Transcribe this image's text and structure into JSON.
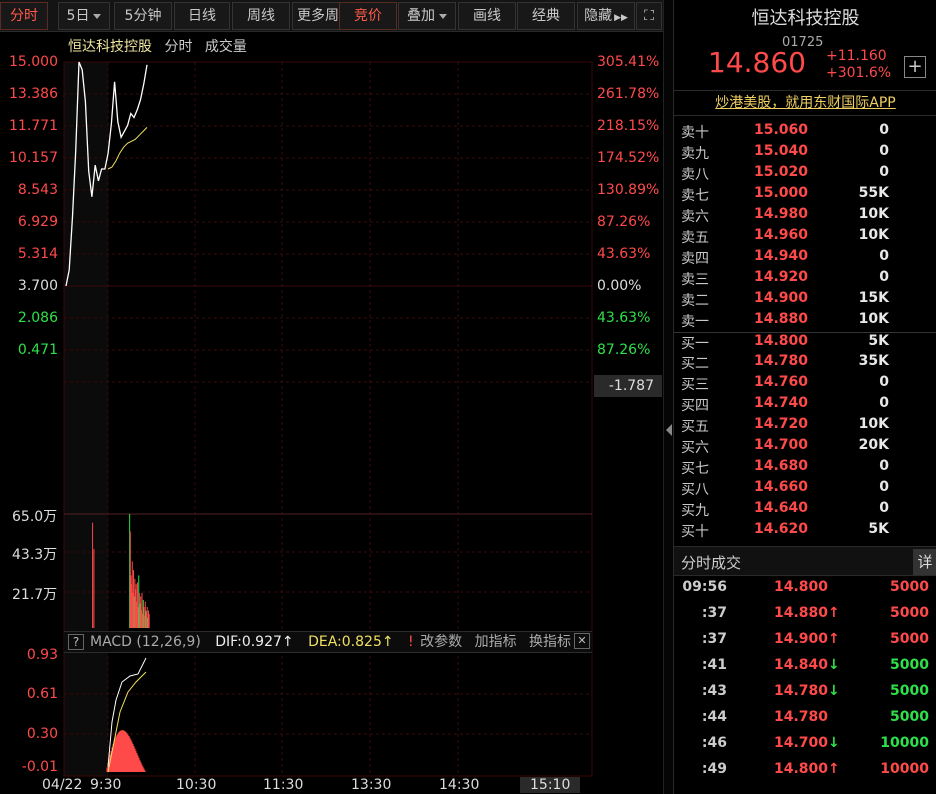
{
  "toolbar": {
    "items": [
      {
        "label": "分时",
        "active": true
      },
      {
        "label": "5日",
        "dropdown": true
      },
      {
        "label": "5分钟"
      },
      {
        "label": "日线"
      },
      {
        "label": "周线"
      },
      {
        "label": "更多周"
      },
      {
        "label": "竞价",
        "active": true
      },
      {
        "label": "叠加",
        "dropdown": true
      },
      {
        "label": "画线"
      },
      {
        "label": "经典"
      },
      {
        "label": "隐藏"
      }
    ],
    "hide_arrows": "▶▶",
    "expand_icon": "⛶"
  },
  "chart": {
    "legend": {
      "name": "恒达科技控股",
      "mode": "分时",
      "vol": "成交量"
    },
    "price_labels_left": [
      "15.000",
      "13.386",
      "11.771",
      "10.157",
      "8.543",
      "6.929",
      "5.314",
      "3.700",
      "2.086",
      "0.471"
    ],
    "pct_labels_right": [
      "305.41%",
      "261.78%",
      "218.15%",
      "174.52%",
      "130.89%",
      "87.26%",
      "43.63%",
      "0.00%",
      "43.63%",
      "87.26%"
    ],
    "cursor_value": "-1.787",
    "volume_labels": [
      "65.0万",
      "43.3万",
      "21.7万"
    ],
    "macd": {
      "help": "?",
      "name": "MACD (12,26,9)",
      "dif": "DIF:0.927",
      "dea": "DEA:0.825",
      "excl": "!",
      "btn_params": "改参数",
      "btn_add": "加指标",
      "btn_switch": "换指标",
      "close": "✕",
      "labels": [
        "0.93",
        "0.61",
        "0.30",
        "-0.01"
      ]
    },
    "time_axis": [
      "04/22",
      "9:30",
      "10:30",
      "11:30",
      "13:30",
      "14:30",
      "15:10"
    ],
    "price_series": [
      3.7,
      4.5,
      7.2,
      10.5,
      15.0,
      14.6,
      13.0,
      9.5,
      8.2,
      9.8,
      9.0,
      9.6,
      9.6,
      10.4,
      11.9,
      14.0,
      12.0,
      11.2,
      11.5,
      11.8,
      12.4,
      12.2,
      12.6,
      13.1,
      13.9,
      14.86
    ],
    "avg_series": [
      9.6,
      9.7,
      10.0,
      10.4,
      10.7,
      10.9,
      11.0,
      11.1,
      11.3,
      11.5,
      11.7
    ],
    "volume_bars": [
      0,
      0,
      0,
      0,
      0,
      0,
      0,
      0,
      0,
      0,
      0,
      0,
      0,
      0,
      0,
      0,
      0,
      0,
      0,
      0,
      0,
      0,
      0,
      0,
      0,
      0,
      0,
      0,
      0,
      0,
      0,
      0,
      0,
      0,
      0,
      0,
      0,
      0,
      0,
      0,
      0,
      0,
      0,
      0,
      60,
      0,
      45,
      0,
      0,
      0,
      0,
      0,
      0,
      0,
      0,
      0,
      0,
      0,
      0,
      0,
      0,
      0,
      0,
      0,
      0,
      0,
      0,
      0,
      0,
      0,
      0,
      0,
      0,
      0,
      0,
      0,
      0,
      0,
      0,
      0,
      0,
      0,
      0,
      0,
      0,
      0,
      0,
      0,
      0,
      0,
      0,
      0,
      0,
      0,
      0,
      0,
      0,
      0,
      0,
      0,
      0,
      65,
      55,
      30,
      25,
      38,
      20,
      33,
      18,
      28,
      22,
      25,
      15,
      26,
      12,
      30,
      20,
      14,
      18,
      10,
      20,
      8,
      16,
      12,
      7,
      15,
      10,
      9,
      12,
      6,
      10,
      8
    ]
  },
  "stock": {
    "name": "恒达科技控股",
    "code": "01725",
    "price": "14.860",
    "change": "+11.160",
    "change_pct": "+301.6%",
    "plus": "+",
    "ad": "炒港美股，就用东财国际APP"
  },
  "orderbook": [
    {
      "label": "卖十",
      "price": "15.060",
      "vol": "0"
    },
    {
      "label": "卖九",
      "price": "15.040",
      "vol": "0"
    },
    {
      "label": "卖八",
      "price": "15.020",
      "vol": "0"
    },
    {
      "label": "卖七",
      "price": "15.000",
      "vol": "55K"
    },
    {
      "label": "卖六",
      "price": "14.980",
      "vol": "10K"
    },
    {
      "label": "卖五",
      "price": "14.960",
      "vol": "10K"
    },
    {
      "label": "卖四",
      "price": "14.940",
      "vol": "0"
    },
    {
      "label": "卖三",
      "price": "14.920",
      "vol": "0"
    },
    {
      "label": "卖二",
      "price": "14.900",
      "vol": "15K"
    },
    {
      "label": "卖一",
      "price": "14.880",
      "vol": "10K"
    },
    {
      "label": "买一",
      "price": "14.800",
      "vol": "5K"
    },
    {
      "label": "买二",
      "price": "14.780",
      "vol": "35K"
    },
    {
      "label": "买三",
      "price": "14.760",
      "vol": "0"
    },
    {
      "label": "买四",
      "price": "14.740",
      "vol": "0"
    },
    {
      "label": "买五",
      "price": "14.720",
      "vol": "10K"
    },
    {
      "label": "买六",
      "price": "14.700",
      "vol": "20K"
    },
    {
      "label": "买七",
      "price": "14.680",
      "vol": "0"
    },
    {
      "label": "买八",
      "price": "14.660",
      "vol": "0"
    },
    {
      "label": "买九",
      "price": "14.640",
      "vol": "0"
    },
    {
      "label": "买十",
      "price": "14.620",
      "vol": "5K"
    }
  ],
  "timesales": {
    "title": "分时成交",
    "detail": "详",
    "rows": [
      {
        "time": "09:56",
        "price": "14.800",
        "arrow": "",
        "dir": "red",
        "vol": "5000",
        "vdir": "red"
      },
      {
        "time": ":37",
        "price": "14.880",
        "arrow": "↑",
        "dir": "red",
        "vol": "5000",
        "vdir": "red"
      },
      {
        "time": ":37",
        "price": "14.900",
        "arrow": "↑",
        "dir": "red",
        "vol": "5000",
        "vdir": "red"
      },
      {
        "time": ":41",
        "price": "14.840",
        "arrow": "↓",
        "dir": "red",
        "vol": "5000",
        "vdir": "green"
      },
      {
        "time": ":43",
        "price": "14.780",
        "arrow": "↓",
        "dir": "red",
        "vol": "5000",
        "vdir": "green"
      },
      {
        "time": ":44",
        "price": "14.780",
        "arrow": "",
        "dir": "red",
        "vol": "5000",
        "vdir": "green"
      },
      {
        "time": ":46",
        "price": "14.700",
        "arrow": "↓",
        "dir": "red",
        "vol": "10000",
        "vdir": "green"
      },
      {
        "time": ":49",
        "price": "14.800",
        "arrow": "↑",
        "dir": "red",
        "vol": "10000",
        "vdir": "red"
      }
    ]
  },
  "colors": {
    "up": "#ff4a4a",
    "down": "#2ee04a",
    "price_line": "#ffffff",
    "avg_line": "#f0e060",
    "grid": "#3a0a0a"
  }
}
